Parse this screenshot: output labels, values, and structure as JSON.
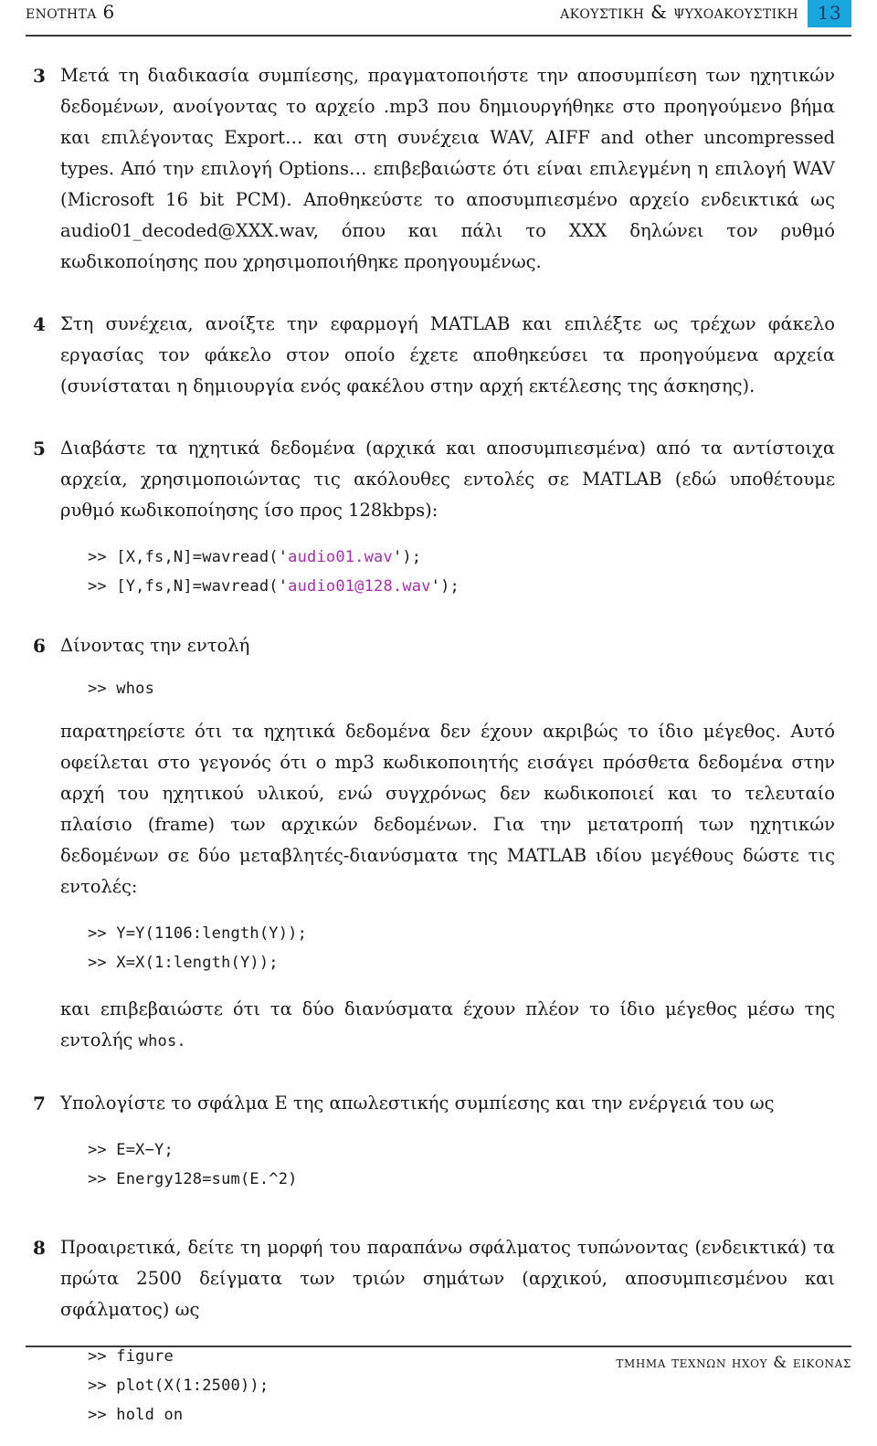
{
  "header": {
    "left_title": "ΕΝΟΤΗΤΑ 6",
    "right_title": "ΑΚΟΥΣΤΙΚΗ & ΨΥΧΟΑΚΟΥΣΤΙΚΗ",
    "page_number": "13",
    "badge_color": "#19a6dd",
    "badge_text_color": "#1f3864"
  },
  "items": {
    "i3": {
      "number": "3",
      "text": "Μετά τη διαδικασία συμπίεσης, πραγματοποιήστε την αποσυμπίεση των ηχητικών δεδομένων, ανοίγοντας το αρχείο .mp3 που δημιουργήθηκε στο προηγούμενο βήμα και επιλέγοντας Export… και στη συνέχεια WAV, AIFF and other uncompressed types. Από την επιλογή Options… επιβεβαιώστε ότι είναι επιλεγμένη η επιλογή WAV (Microsoft 16 bit PCM). Αποθηκεύστε το αποσυμπιεσμένο αρχείο ενδεικτικά ως audio01_decoded@XXX.wav, όπου και πάλι το ΧΧΧ δηλώνει τον ρυθμό κωδικοποίησης που χρησιμοποιήθηκε προηγουμένως."
    },
    "i4": {
      "number": "4",
      "text": "Στη συνέχεια, ανοίξτε την εφαρμογή MATLAB και επιλέξτε ως τρέχων φάκελο εργασίας τον φάκελο στον οποίο έχετε αποθηκεύσει τα προηγούμενα αρχεία (συνίσταται η δημιουργία ενός φακέλου στην αρχή εκτέλεσης της άσκησης)."
    },
    "i5": {
      "number": "5",
      "text": "Διαβάστε τα ηχητικά δεδομένα (αρχικά και αποσυμπιεσμένα) από τα αντίστοιχα αρχεία, χρησιμοποιώντας τις ακόλουθες εντολές σε MATLAB (εδώ υποθέτουμε ρυθμό κωδικοποίησης ίσο προς 128kbps):",
      "code": {
        "line1_prompt": ">> ",
        "line1_pre": "[X,fs,N]=wavread('",
        "line1_str": "audio01.wav",
        "line1_post": "');",
        "line2_prompt": ">> ",
        "line2_pre": "[Y,fs,N]=wavread('",
        "line2_str": "audio01@128.wav",
        "line2_post": "');"
      }
    },
    "i6": {
      "number": "6",
      "intro": "Δίνοντας την εντολή",
      "code1": ">> whos",
      "body": "παρατηρείστε ότι τα ηχητικά δεδομένα δεν έχουν ακριβώς το ίδιο μέγεθος. Αυτό οφείλεται στο γεγονός ότι ο mp3 κωδικοποιητής εισάγει πρόσθετα δεδομένα στην αρχή του ηχητικού υλικού, ενώ συγχρόνως δεν κωδικοποιεί και το τελευταίο πλαίσιο (frame) των αρχικών δεδομένων. Για την μετατροπή των ηχητικών δεδομένων σε δύο μεταβλητές-διανύσματα της MATLAB ιδίου μεγέθους δώστε τις εντολές:",
      "code2_line1": ">> Y=Y(1106:length(Y));",
      "code2_line2": ">> X=X(1:length(Y));",
      "closing": "και επιβεβαιώστε ότι τα δύο διανύσματα έχουν πλέον το ίδιο μέγεθος μέσω της εντολής",
      "closing_code": "whos."
    },
    "i7": {
      "number": "7",
      "text": "Υπολογίστε το σφάλμα Ε της απωλεστικής συμπίεσης και την ενέργειά του ως",
      "code_line1": ">> E=X−Y;",
      "code_line2": ">> Energy128=sum(E.^2)"
    },
    "i8": {
      "number": "8",
      "text": "Προαιρετικά, δείτε τη μορφή του παραπάνω σφάλματος τυπώνοντας (ενδεικτικά) τα πρώτα 2500 δείγματα των τριών σημάτων (αρχικού, αποσυμπιεσμένου και σφάλματος) ως",
      "code_line1": ">> figure",
      "code_line2": ">> plot(X(1:2500));",
      "code_line3": ">> hold on"
    }
  },
  "footer": {
    "text": "ΤΜΗΜΑ ΤΕΧΝΩΝ ΗΧΟΥ & ΕΙΚΟΝΑΣ"
  }
}
